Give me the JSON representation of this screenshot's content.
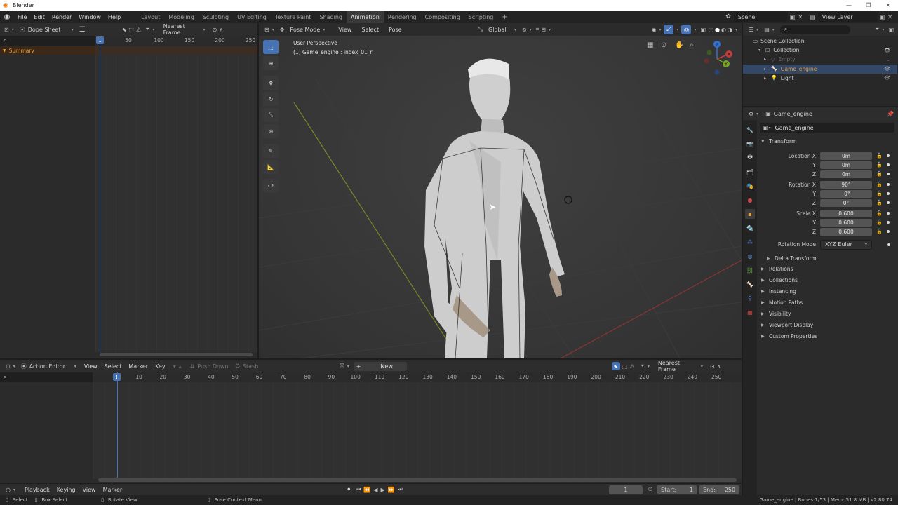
{
  "window": {
    "title": "Blender"
  },
  "topbar": {
    "menus": [
      "File",
      "Edit",
      "Render",
      "Window",
      "Help"
    ],
    "workspaces": [
      "Layout",
      "Modeling",
      "Sculpting",
      "UV Editing",
      "Texture Paint",
      "Shading",
      "Animation",
      "Rendering",
      "Compositing",
      "Scripting"
    ],
    "active_workspace": "Animation",
    "add_tab": "+",
    "scene": "Scene",
    "view_layer": "View Layer"
  },
  "dopesheet": {
    "mode": "Dope Sheet",
    "snap": "Nearest Frame",
    "summary": "Summary",
    "current_frame": "1",
    "ticks": [
      "50",
      "100",
      "150",
      "200",
      "250"
    ]
  },
  "viewport": {
    "mode": "Pose Mode",
    "menus": [
      "View",
      "Select",
      "Pose"
    ],
    "orientation": "Global",
    "info_line1": "User Perspective",
    "info_line2": "(1) Game_engine : index_01_r",
    "gizmo_axes": [
      "Z",
      "Y",
      "X"
    ]
  },
  "outliner": {
    "root": "Scene Collection",
    "items": [
      {
        "label": "Collection",
        "color": "#cfcfcf"
      },
      {
        "label": "Empty",
        "color": "#6b6b6b"
      },
      {
        "label": "Game_engine",
        "color": "#e6a050"
      },
      {
        "label": "Light",
        "color": "#cfcfcf"
      }
    ]
  },
  "properties": {
    "object_name": "Game_engine",
    "object_field": "Game_engine",
    "transform_label": "Transform",
    "rows": [
      {
        "label": "Location X",
        "value": "0m"
      },
      {
        "label": "Y",
        "value": "0m"
      },
      {
        "label": "Z",
        "value": "0m"
      },
      {
        "label": "Rotation X",
        "value": "90°"
      },
      {
        "label": "Y",
        "value": "-0°"
      },
      {
        "label": "Z",
        "value": "0°"
      },
      {
        "label": "Scale X",
        "value": "0.600"
      },
      {
        "label": "Y",
        "value": "0.600"
      },
      {
        "label": "Z",
        "value": "0.600"
      }
    ],
    "rotation_mode_label": "Rotation Mode",
    "rotation_mode": "XYZ Euler",
    "delta": "Delta Transform",
    "sections": [
      "Relations",
      "Collections",
      "Instancing",
      "Motion Paths",
      "Visibility",
      "Viewport Display",
      "Custom Properties"
    ]
  },
  "action_editor": {
    "mode": "Action Editor",
    "menus": [
      "View",
      "Select",
      "Marker",
      "Key"
    ],
    "push_down": "Push Down",
    "stash": "Stash",
    "new": "New",
    "snap": "Nearest Frame",
    "current_frame": "1",
    "ticks": [
      "10",
      "20",
      "30",
      "40",
      "50",
      "60",
      "70",
      "80",
      "90",
      "100",
      "110",
      "120",
      "130",
      "140",
      "150",
      "160",
      "170",
      "180",
      "190",
      "200",
      "210",
      "220",
      "230",
      "240",
      "250"
    ]
  },
  "timeline": {
    "menus": [
      "Playback",
      "Keying",
      "View",
      "Marker"
    ],
    "frame": "1",
    "start_label": "Start:",
    "start": "1",
    "end_label": "End:",
    "end": "250"
  },
  "statusbar": {
    "select": "Select",
    "box_select": "Box Select",
    "rotate_view": "Rotate View",
    "context_menu": "Pose Context Menu",
    "stats": "Game_engine | Bones:1/53 | Mem: 51.8 MB | v2.80.74"
  }
}
